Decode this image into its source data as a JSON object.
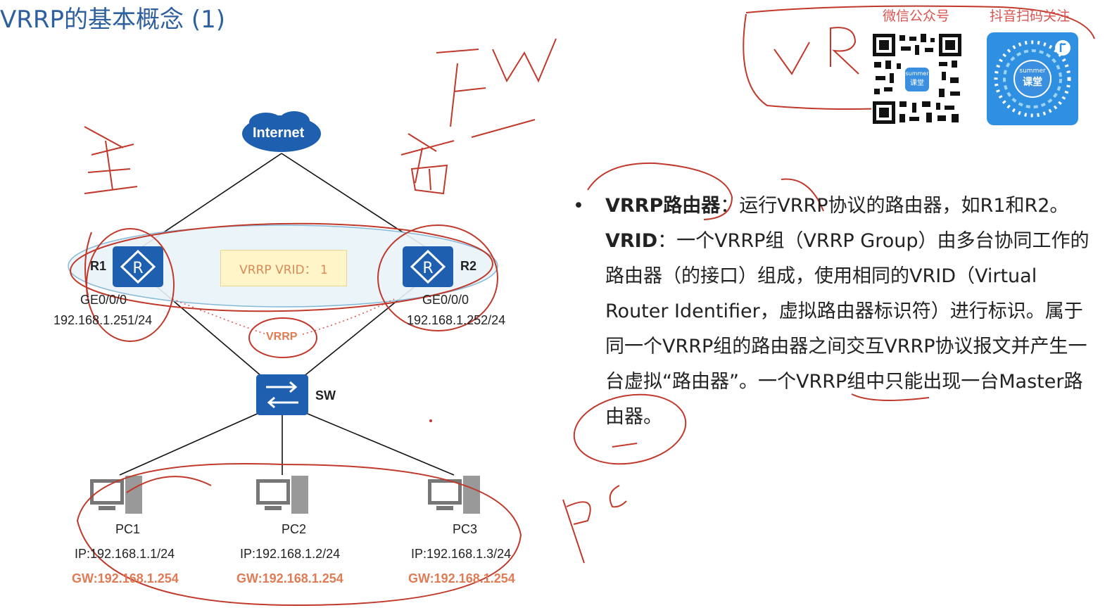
{
  "title": "VRRP的基本概念 (1)",
  "qr": {
    "wechat_label": "微信公众号",
    "douyin_label": "抖音扫码关注",
    "logo_top": "summer",
    "logo_bottom": "课堂"
  },
  "diagram": {
    "internet": "Internet",
    "r1": "R1",
    "r2": "R2",
    "vrid_box": "VRRP VRID： 1",
    "r1_if": "GE0/0/0",
    "r1_ip": "192.168.1.251/24",
    "r2_if": "GE0/0/0",
    "r2_ip": "192.168.1.252/24",
    "vrrp": "VRRP",
    "sw": "SW",
    "pcs": [
      {
        "name": "PC1",
        "ip": "IP:192.168.1.1/24",
        "gw": "GW:192.168.1.254"
      },
      {
        "name": "PC2",
        "ip": "IP:192.168.1.2/24",
        "gw": "GW:192.168.1.254"
      },
      {
        "name": "PC3",
        "ip": "IP:192.168.1.3/24",
        "gw": "GW:192.168.1.254"
      }
    ]
  },
  "content": {
    "bullet": "•",
    "term1": "VRRP路由器",
    "text1": "：运行VRRP协议的路由器，如R1和R2。",
    "term2": "VRID",
    "text2": "：一个VRRP组（VRRP Group）由多台协同工作的路由器（的接口）组成，使用相同的VRID（Virtual Router Identifier，虚拟路由器标识符）进行标识。属于同一个VRRP组的路由器之间交互VRRP协议报文并产生一台虚拟“路由器”。一个VRRP组中只能出现一台Master路由器。"
  },
  "colors": {
    "title": "#2e5f9e",
    "device_blue": "#1f5fb0",
    "annotation_red": "#c0392b",
    "gw_orange": "#e07b54"
  }
}
